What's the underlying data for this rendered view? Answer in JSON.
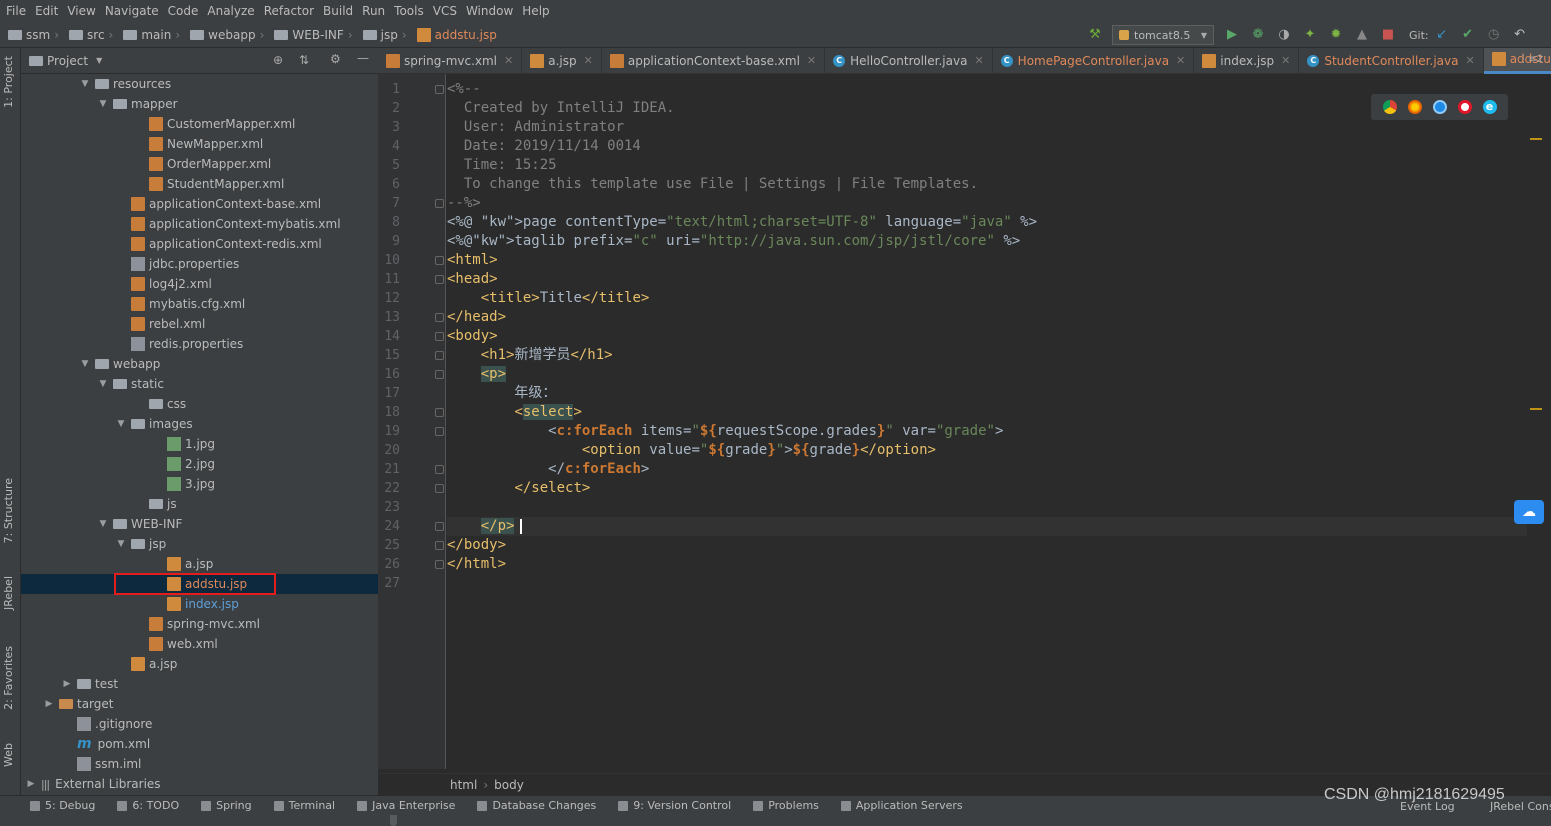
{
  "menu": [
    "File",
    "Edit",
    "View",
    "Navigate",
    "Code",
    "Analyze",
    "Refactor",
    "Build",
    "Run",
    "Tools",
    "VCS",
    "Window",
    "Help"
  ],
  "breadcrumb": [
    "ssm",
    "src",
    "main",
    "webapp",
    "WEB-INF",
    "jsp",
    "addstu.jsp"
  ],
  "toolbar": {
    "run_config": "tomcat8.5",
    "git_label": "Git:"
  },
  "side_tabs": {
    "project": "1: Project",
    "structure": "7: Structure",
    "jrebel": "JRebel",
    "favorites": "2: Favorites",
    "web": "Web"
  },
  "project_panel": {
    "title": "Project"
  },
  "tree": [
    {
      "label": "resources",
      "type": "folder",
      "indent": 3,
      "arrow": "down"
    },
    {
      "label": "mapper",
      "type": "folder",
      "indent": 4,
      "arrow": "down"
    },
    {
      "label": "CustomerMapper.xml",
      "type": "xml",
      "indent": 6
    },
    {
      "label": "NewMapper.xml",
      "type": "xml",
      "indent": 6
    },
    {
      "label": "OrderMapper.xml",
      "type": "xml",
      "indent": 6
    },
    {
      "label": "StudentMapper.xml",
      "type": "xml",
      "indent": 6
    },
    {
      "label": "applicationContext-base.xml",
      "type": "xml",
      "indent": 5
    },
    {
      "label": "applicationContext-mybatis.xml",
      "type": "xml",
      "indent": 5
    },
    {
      "label": "applicationContext-redis.xml",
      "type": "xml",
      "indent": 5
    },
    {
      "label": "jdbc.properties",
      "type": "prop",
      "indent": 5
    },
    {
      "label": "log4j2.xml",
      "type": "xml",
      "indent": 5
    },
    {
      "label": "mybatis.cfg.xml",
      "type": "xml",
      "indent": 5
    },
    {
      "label": "rebel.xml",
      "type": "xml",
      "indent": 5
    },
    {
      "label": "redis.properties",
      "type": "prop",
      "indent": 5
    },
    {
      "label": "webapp",
      "type": "folder",
      "indent": 3,
      "arrow": "down"
    },
    {
      "label": "static",
      "type": "folder",
      "indent": 4,
      "arrow": "down"
    },
    {
      "label": "css",
      "type": "folder",
      "indent": 6
    },
    {
      "label": "images",
      "type": "folder",
      "indent": 5,
      "arrow": "down"
    },
    {
      "label": "1.jpg",
      "type": "img",
      "indent": 7
    },
    {
      "label": "2.jpg",
      "type": "img",
      "indent": 7
    },
    {
      "label": "3.jpg",
      "type": "img",
      "indent": 7
    },
    {
      "label": "js",
      "type": "folder",
      "indent": 6
    },
    {
      "label": "WEB-INF",
      "type": "folder",
      "indent": 4,
      "arrow": "down"
    },
    {
      "label": "jsp",
      "type": "folder",
      "indent": 5,
      "arrow": "down"
    },
    {
      "label": "a.jsp",
      "type": "jsp",
      "indent": 7
    },
    {
      "label": "addstu.jsp",
      "type": "jsp",
      "indent": 7,
      "selected": true
    },
    {
      "label": "index.jsp",
      "type": "jsp",
      "indent": 7,
      "blue": true
    },
    {
      "label": "spring-mvc.xml",
      "type": "xml",
      "indent": 6
    },
    {
      "label": "web.xml",
      "type": "xml",
      "indent": 6
    },
    {
      "label": "a.jsp",
      "type": "jsp",
      "indent": 5
    },
    {
      "label": "test",
      "type": "folder",
      "indent": 2,
      "arrow": "right"
    },
    {
      "label": "target",
      "type": "folder-orange",
      "indent": 1,
      "arrow": "right"
    },
    {
      "label": ".gitignore",
      "type": "prop",
      "indent": 2
    },
    {
      "label": "pom.xml",
      "type": "maven",
      "indent": 2
    },
    {
      "label": "ssm.iml",
      "type": "prop",
      "indent": 2
    },
    {
      "label": "External Libraries",
      "type": "lib",
      "indent": 0,
      "arrow": "right"
    }
  ],
  "tabs": [
    {
      "label": "spring-mvc.xml",
      "icon": "xml"
    },
    {
      "label": "a.jsp",
      "icon": "jsp"
    },
    {
      "label": "applicationContext-base.xml",
      "icon": "xml"
    },
    {
      "label": "HelloController.java",
      "icon": "java"
    },
    {
      "label": "HomePageController.java",
      "icon": "java",
      "orange": true
    },
    {
      "label": "index.jsp",
      "icon": "jsp"
    },
    {
      "label": "StudentController.java",
      "icon": "java",
      "orange": true
    },
    {
      "label": "addstu.jsp",
      "icon": "jsp",
      "active": true,
      "orange": true
    }
  ],
  "tab_overflow": "2",
  "code_lines": [
    "<%--",
    "  Created by IntelliJ IDEA.",
    "  User: Administrator",
    "  Date: 2019/11/14 0014",
    "  Time: 15:25",
    "  To change this template use File | Settings | File Templates.",
    "--%>",
    "<%@ page contentType=\"text/html;charset=UTF-8\" language=\"java\" %>",
    "<%@taglib prefix=\"c\" uri=\"http://java.sun.com/jsp/jstl/core\" %>",
    "<html>",
    "<head>",
    "    <title>Title</title>",
    "</head>",
    "<body>",
    "    <h1>新增学员</h1>",
    "    <p>",
    "        年级：",
    "        <select>",
    "            <c:forEach items=\"${requestScope.grades}\" var=\"grade\">",
    "                <option value=\"${grade}\">${grade}</option>",
    "            </c:forEach>",
    "        </select>",
    "",
    "    </p>",
    "</body>",
    "</html>",
    ""
  ],
  "editor_breadcrumb": [
    "html",
    "body"
  ],
  "bottom_tools": [
    {
      "label": "5: Debug",
      "icon": "bug-icon"
    },
    {
      "label": "6: TODO",
      "icon": "todo-icon"
    },
    {
      "label": "Spring",
      "icon": "spring-icon"
    },
    {
      "label": "Terminal",
      "icon": "terminal-icon"
    },
    {
      "label": "Java Enterprise",
      "icon": "javaee-icon"
    },
    {
      "label": "Database Changes",
      "icon": "database-icon"
    },
    {
      "label": "9: Version Control",
      "icon": "vcs-icon"
    },
    {
      "label": "Problems",
      "icon": "warning-icon"
    },
    {
      "label": "Application Servers",
      "icon": "server-icon"
    }
  ],
  "bottom_right": {
    "event_log": "Event Log",
    "jrebel_console": "JRebel Cons"
  },
  "watermark": "CSDN @hmj2181629495",
  "colors": {
    "background": "#2b2b2b",
    "panel": "#3c3f41",
    "selection": "#0d293e",
    "accent": "#4a88c7",
    "highlight_box": "#e51c1c"
  }
}
